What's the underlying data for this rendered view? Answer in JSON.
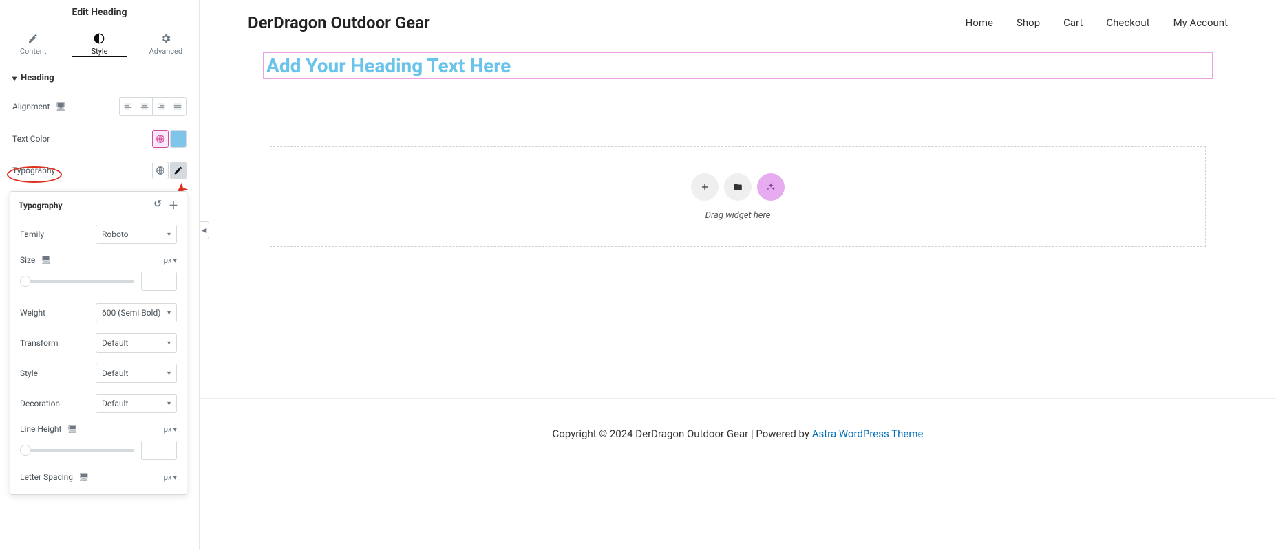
{
  "panel": {
    "title": "Edit Heading",
    "tabs": {
      "content": "Content",
      "style": "Style",
      "advanced": "Advanced"
    },
    "section": "Heading",
    "controls": {
      "alignment_label": "Alignment",
      "text_color_label": "Text Color",
      "typography_label": "Typography"
    }
  },
  "typography": {
    "title": "Typography",
    "family_label": "Family",
    "family_value": "Roboto",
    "size_label": "Size",
    "size_unit": "px",
    "weight_label": "Weight",
    "weight_value": "600 (Semi Bold)",
    "transform_label": "Transform",
    "transform_value": "Default",
    "style_label": "Style",
    "style_value": "Default",
    "decoration_label": "Decoration",
    "decoration_value": "Default",
    "line_height_label": "Line Height",
    "line_height_unit": "px",
    "letter_spacing_label": "Letter Spacing",
    "letter_spacing_unit": "px"
  },
  "canvas": {
    "site_title": "DerDragon Outdoor Gear",
    "nav": {
      "home": "Home",
      "shop": "Shop",
      "cart": "Cart",
      "checkout": "Checkout",
      "account": "My Account"
    },
    "heading": "Add Your Heading Text Here",
    "dropzone_hint": "Drag widget here",
    "footer_prefix": "Copyright © 2024 DerDragon Outdoor Gear | Powered by ",
    "footer_link": "Astra WordPress Theme"
  },
  "colors": {
    "heading_color": "#69c3ea",
    "highlight_pink": "#d2509b"
  }
}
